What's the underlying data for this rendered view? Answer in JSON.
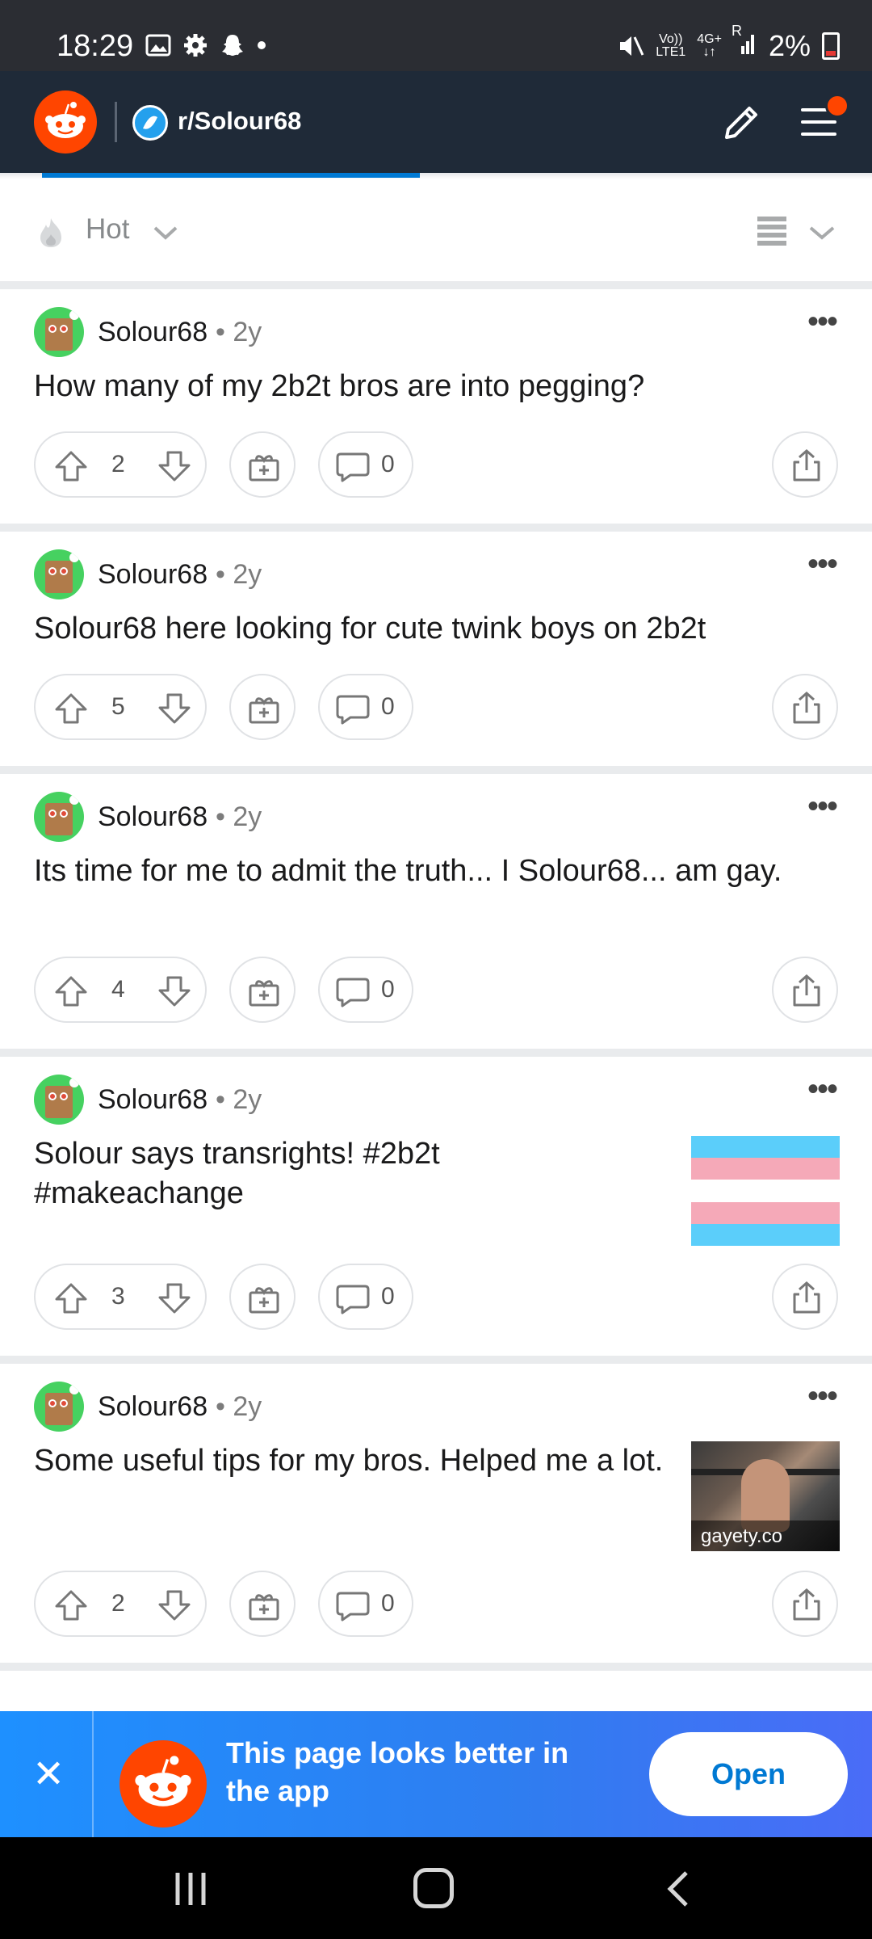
{
  "status_bar": {
    "time": "18:29",
    "network_top": "Vo))",
    "network_bottom": "LTE1",
    "data_type": "4G+",
    "roaming": "R",
    "battery": "2%"
  },
  "header": {
    "subreddit": "r/Solour68"
  },
  "sort": {
    "label": "Hot"
  },
  "posts": [
    {
      "author": "Solour68",
      "age": "2y",
      "title": "How many of my 2b2t bros are into pegging?",
      "score": "2",
      "comments": "0"
    },
    {
      "author": "Solour68",
      "age": "2y",
      "title": "Solour68 here looking for cute twink boys on 2b2t",
      "score": "5",
      "comments": "0"
    },
    {
      "author": "Solour68",
      "age": "2y",
      "title": "Its time for me to admit the truth... I Solour68... am gay.",
      "score": "4",
      "comments": "0"
    },
    {
      "author": "Solour68",
      "age": "2y",
      "title": "Solour says transrights! #2b2t #makeachange",
      "score": "3",
      "comments": "0"
    },
    {
      "author": "Solour68",
      "age": "2y",
      "title": "Some useful tips for my bros. Helped me a lot.",
      "score": "2",
      "comments": "0",
      "thumbnail_domain": "gayety.co"
    }
  ],
  "banner": {
    "text": "This page looks better in the app",
    "open_label": "Open",
    "close_label": "✕"
  },
  "flag_colors": [
    "#5bcefa",
    "#f5a9b8",
    "#ffffff",
    "#f5a9b8",
    "#5bcefa"
  ]
}
